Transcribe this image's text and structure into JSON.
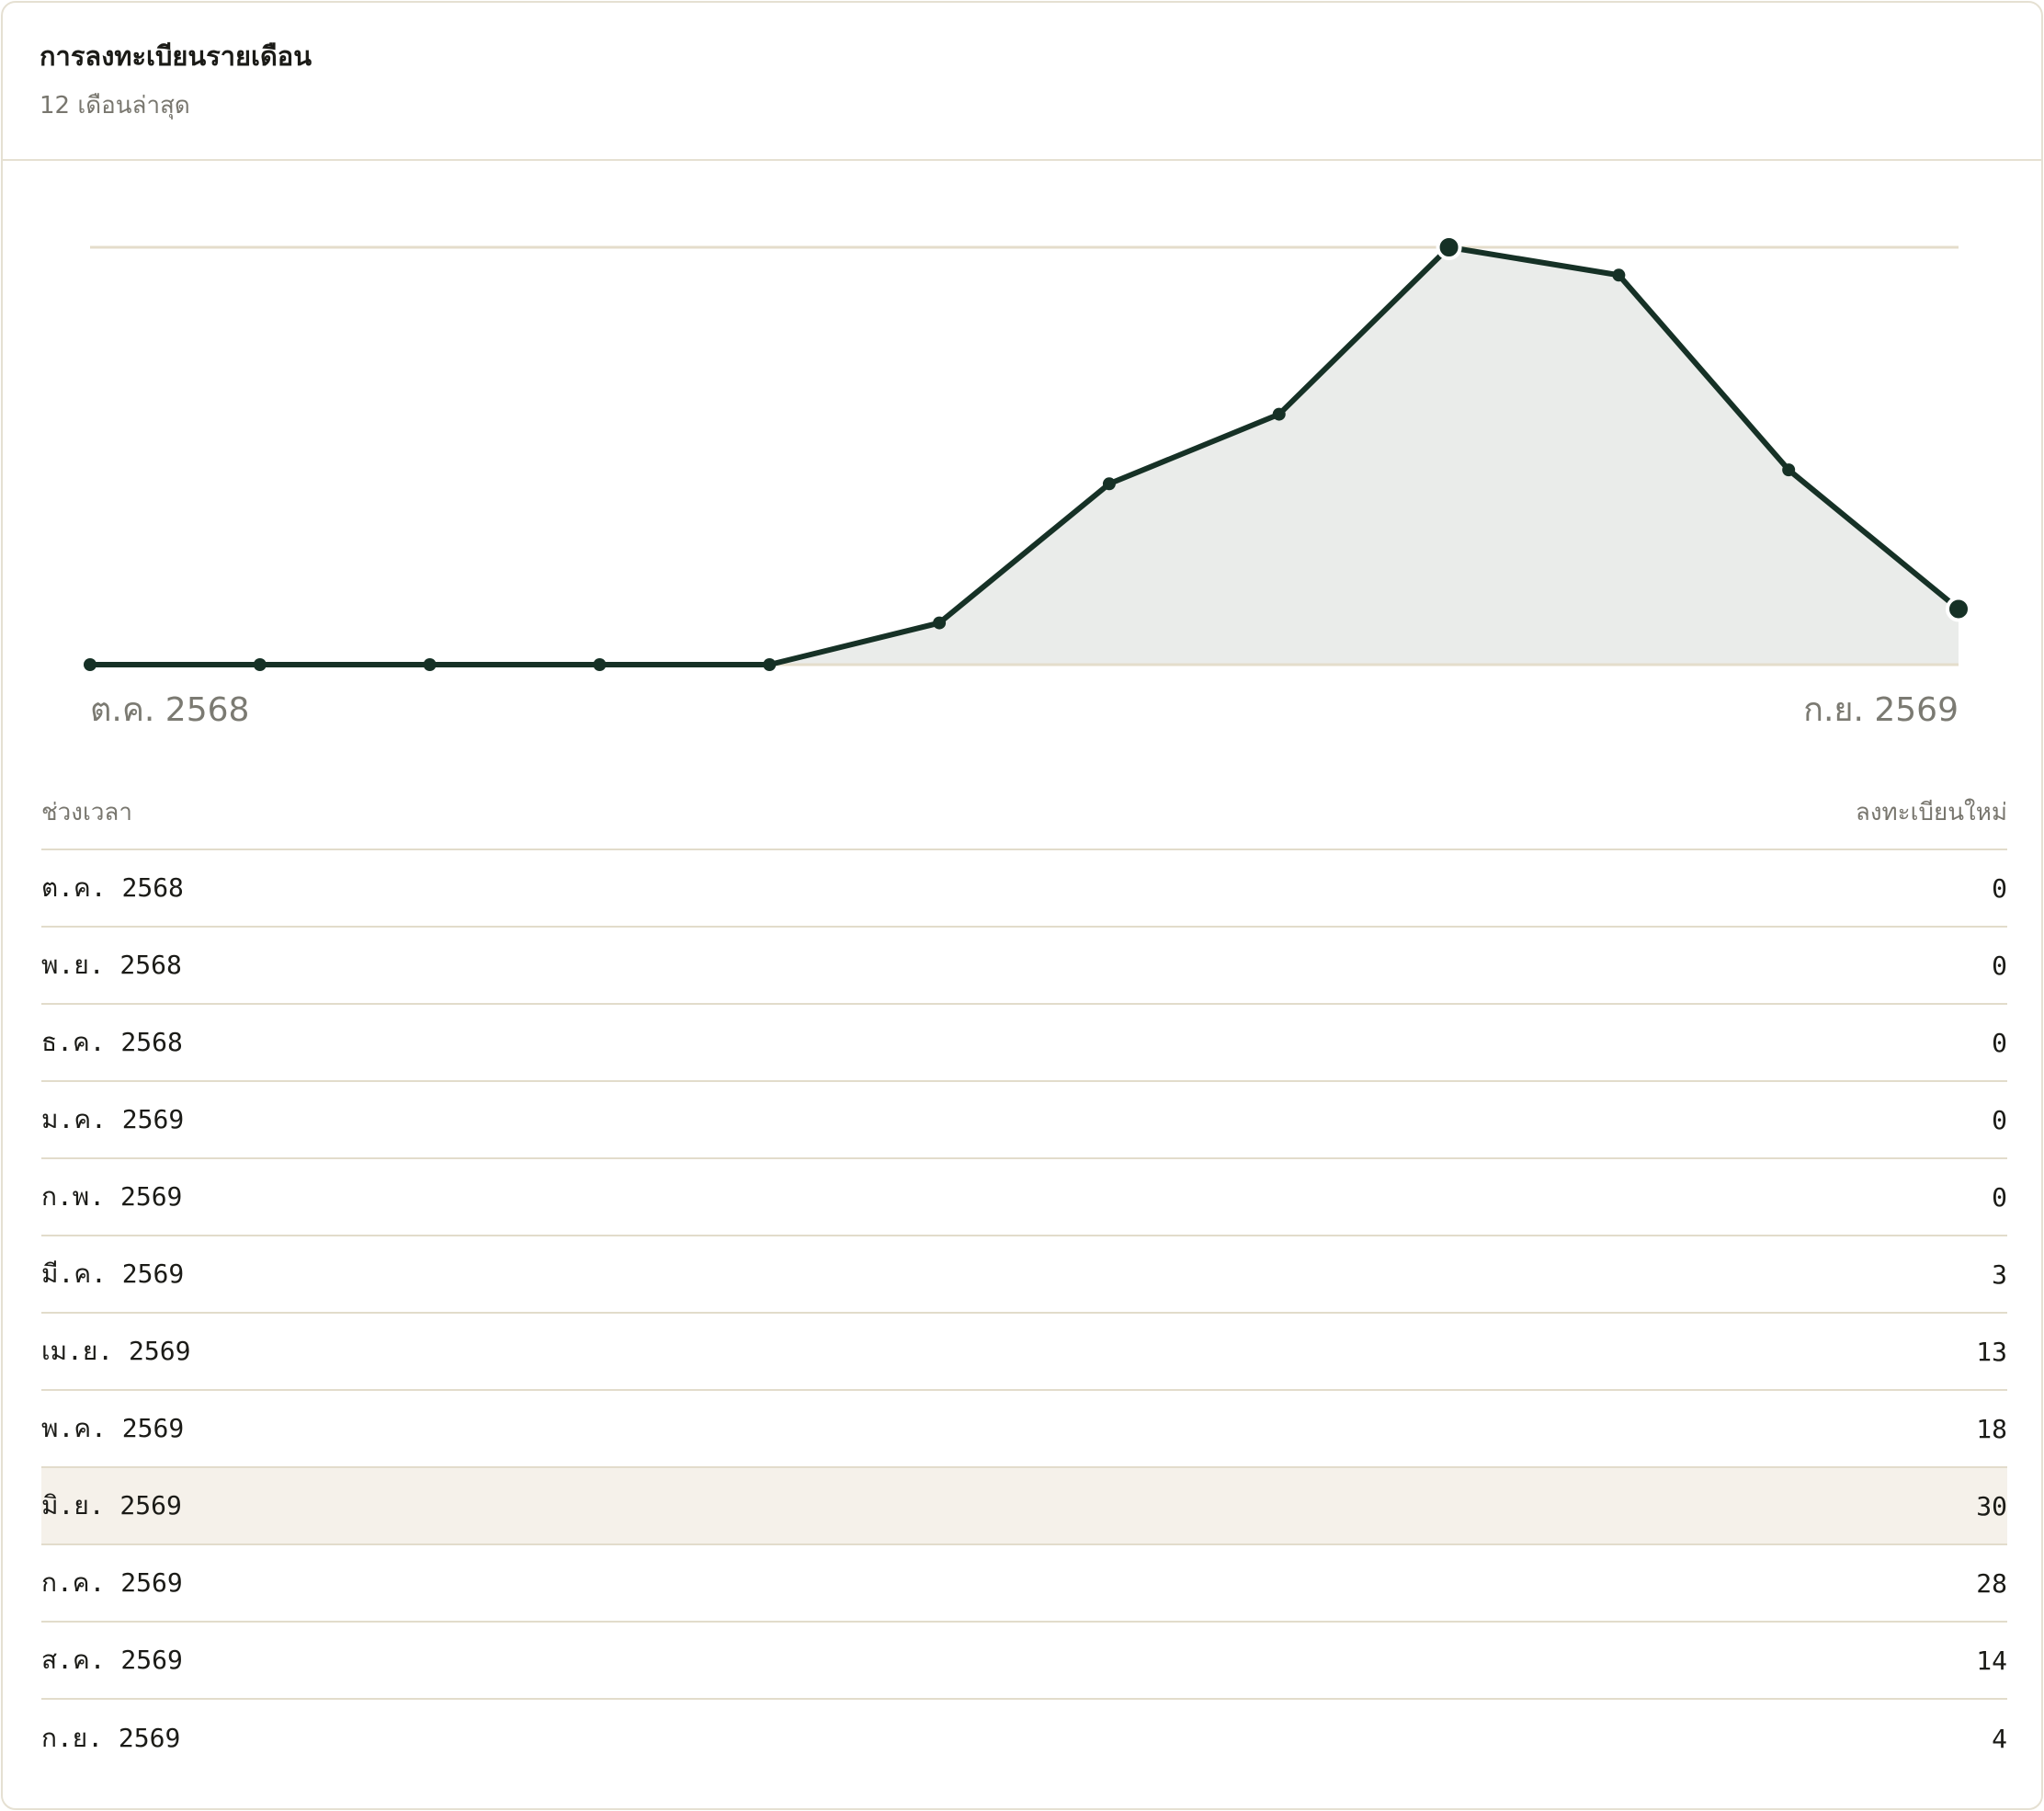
{
  "card": {
    "title": "การลงทะเบียนรายเดือน",
    "subtitle": "12 เดือนล่าสุด"
  },
  "colors": {
    "line": "#163126",
    "area_fill": "#eaecea",
    "gridline": "#e4ddcb",
    "border": "#e5e0d2",
    "highlight_row": "#f5f1ea"
  },
  "chart_data": {
    "type": "line",
    "x": [
      "ต.ค. 2568",
      "พ.ย. 2568",
      "ธ.ค. 2568",
      "ม.ค. 2569",
      "ก.พ. 2569",
      "มี.ค. 2569",
      "เม.ย. 2569",
      "พ.ค. 2569",
      "มิ.ย. 2569",
      "ก.ค. 2569",
      "ส.ค. 2569",
      "ก.ย. 2569"
    ],
    "values": [
      0,
      0,
      0,
      0,
      0,
      3,
      13,
      18,
      30,
      28,
      14,
      4
    ],
    "x_labels_shown": [
      "ต.ค. 2568",
      "ก.ย. 2569"
    ],
    "ylim": [
      0,
      30
    ],
    "grid": true,
    "emphasized_points": [
      "มิ.ย. 2569",
      "ก.ย. 2569"
    ],
    "area_fill": true
  },
  "table": {
    "header_period": "ช่วงเวลา",
    "header_count": "ลงทะเบียนใหม่",
    "highlighted_row": "มิ.ย. 2569",
    "rows": [
      {
        "period": "ต.ค. 2568",
        "count": "0"
      },
      {
        "period": "พ.ย. 2568",
        "count": "0"
      },
      {
        "period": "ธ.ค. 2568",
        "count": "0"
      },
      {
        "period": "ม.ค. 2569",
        "count": "0"
      },
      {
        "period": "ก.พ. 2569",
        "count": "0"
      },
      {
        "period": "มี.ค. 2569",
        "count": "3"
      },
      {
        "period": "เม.ย. 2569",
        "count": "13"
      },
      {
        "period": "พ.ค. 2569",
        "count": "18"
      },
      {
        "period": "มิ.ย. 2569",
        "count": "30"
      },
      {
        "period": "ก.ค. 2569",
        "count": "28"
      },
      {
        "period": "ส.ค. 2569",
        "count": "14"
      },
      {
        "period": "ก.ย. 2569",
        "count": "4"
      }
    ]
  }
}
